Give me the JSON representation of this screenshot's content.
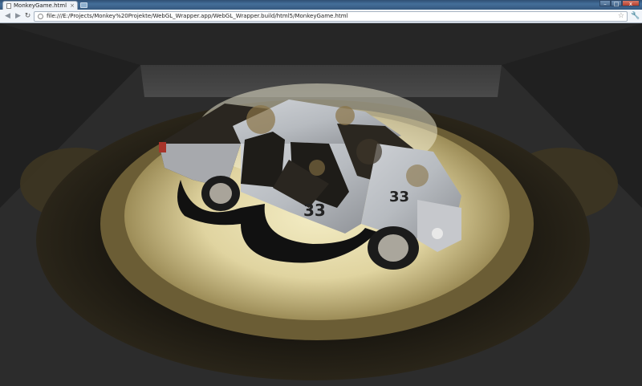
{
  "browser": {
    "tab_title": "MonkeyGame.html",
    "tab_close": "×",
    "url": "file:///E:/Projects/Monkey%20Projekte/WebGL_Wrapper.app/WebGL_Wrapper.build/html5/MonkeyGame.html",
    "window_buttons": {
      "minimize": "–",
      "maximize": "□",
      "close": "x"
    }
  },
  "scene": {
    "description_icons": [
      "truck-model",
      "spotlight",
      "floor"
    ],
    "car_number": "33"
  }
}
